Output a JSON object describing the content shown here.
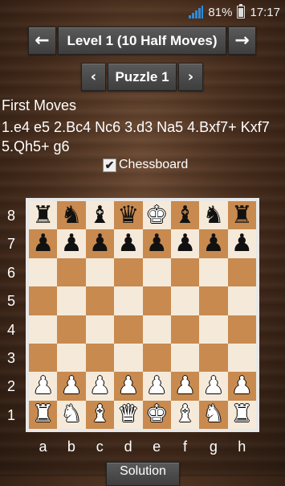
{
  "status": {
    "battery": "81%",
    "time": "17:17"
  },
  "nav": {
    "prev_level_icon": "←",
    "level_label": "Level 1 (10 Half Moves)",
    "next_level_icon": "→",
    "prev_puzzle_icon": "‹",
    "puzzle_label": "Puzzle 1",
    "next_puzzle_icon": "›"
  },
  "moves": {
    "title": "First Moves",
    "text": "1.e4 e5 2.Bc4 Nc6 3.d3 Na5 4.Bxf7+ Kxf7 5.Qh5+ g6"
  },
  "options": {
    "chessboard_label": "Chessboard",
    "chessboard_checked": true,
    "check_mark": "✔"
  },
  "board": {
    "ranks": [
      "8",
      "7",
      "6",
      "5",
      "4",
      "3",
      "2",
      "1"
    ],
    "files": [
      "a",
      "b",
      "c",
      "d",
      "e",
      "f",
      "g",
      "h"
    ],
    "rows": [
      [
        "bR",
        "bN",
        "bB",
        "bQ",
        "wK",
        "bB",
        "bN",
        "bR"
      ],
      [
        "bP",
        "bP",
        "bP",
        "bP",
        "bP",
        "bP",
        "bP",
        "bP"
      ],
      [
        "",
        "",
        "",
        "",
        "",
        "",
        "",
        ""
      ],
      [
        "",
        "",
        "",
        "",
        "",
        "",
        "",
        ""
      ],
      [
        "",
        "",
        "",
        "",
        "",
        "",
        "",
        ""
      ],
      [
        "",
        "",
        "",
        "",
        "",
        "",
        "",
        ""
      ],
      [
        "wP",
        "wP",
        "wP",
        "wP",
        "wP",
        "wP",
        "wP",
        "wP"
      ],
      [
        "wR",
        "wN",
        "wB",
        "wQ",
        "wK",
        "wB",
        "wN",
        "wR"
      ]
    ]
  },
  "solution_label": "Solution"
}
